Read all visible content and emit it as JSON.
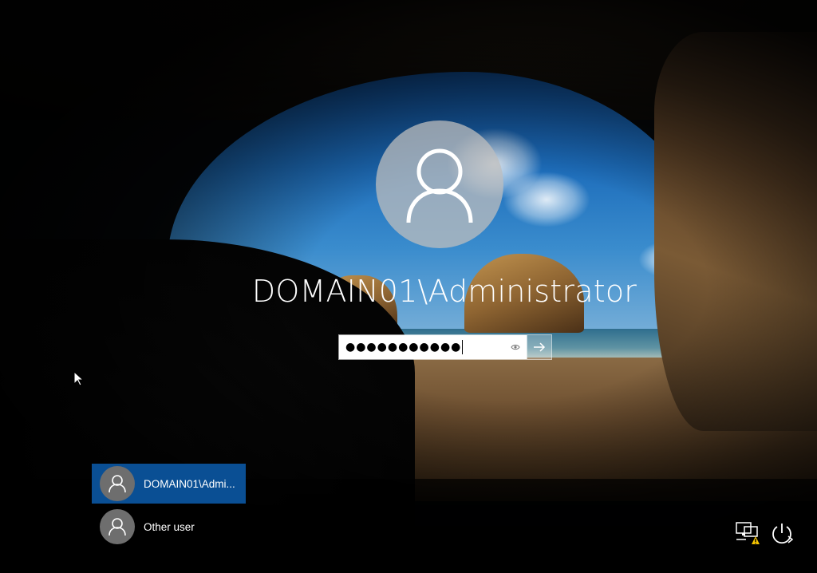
{
  "login": {
    "username": "DOMAIN01\\Administrator",
    "password_masked": "●●●●●●●●●●●",
    "submit_icon": "arrow-right-icon",
    "reveal_icon": "eye-icon",
    "avatar_icon": "user-icon"
  },
  "user_list": {
    "items": [
      {
        "label": "DOMAIN01\\Admi...",
        "selected": true,
        "icon": "user-icon"
      },
      {
        "label": "Other user",
        "selected": false,
        "icon": "user-icon"
      }
    ]
  },
  "system_tray": {
    "network_icon": "network-warning-icon",
    "power_icon": "power-icon"
  },
  "colors": {
    "selected_tile": "#0a4f94",
    "avatar_bg": "#bebebe",
    "warning": "#f5c400"
  }
}
